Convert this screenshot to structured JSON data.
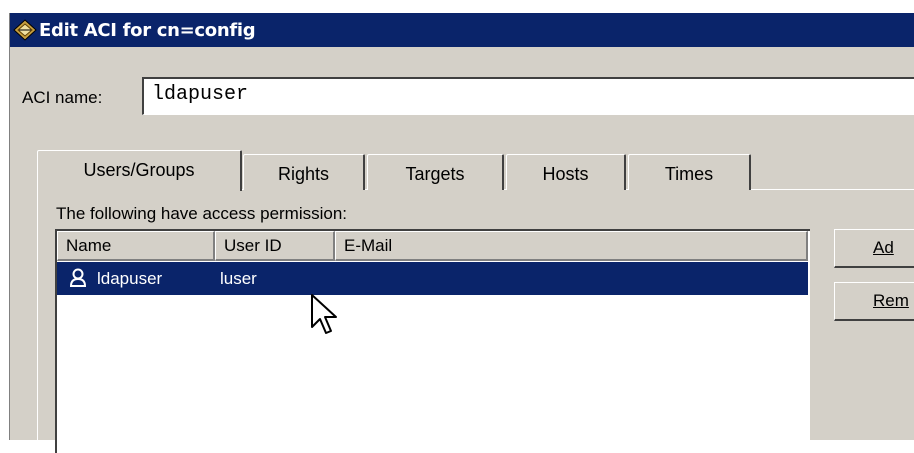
{
  "window": {
    "title": "Edit ACI for cn=config"
  },
  "aci": {
    "label": "ACI name:",
    "value": "ldapuser"
  },
  "tabs": [
    {
      "label": "Users/Groups",
      "active": true
    },
    {
      "label": "Rights"
    },
    {
      "label": "Targets"
    },
    {
      "label": "Hosts"
    },
    {
      "label": "Times"
    }
  ],
  "permissions": {
    "label": "The following have access permission:",
    "columns": [
      "Name",
      "User ID",
      "E-Mail"
    ],
    "rows": [
      {
        "name": "ldapuser",
        "user_id": "luser",
        "email": ""
      }
    ]
  },
  "buttons": {
    "add": "Ad",
    "remove": "Rem"
  },
  "colors": {
    "titlebar": "#0a246a",
    "selection": "#0a246a",
    "face": "#d4d0c8"
  }
}
